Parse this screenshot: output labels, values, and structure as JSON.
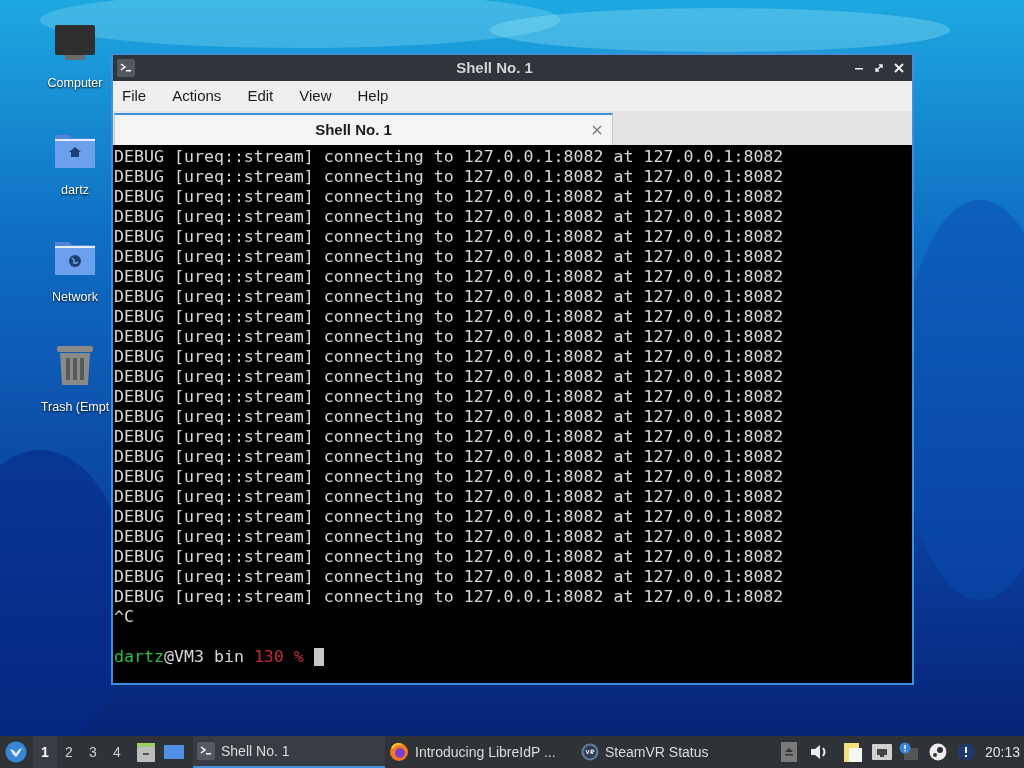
{
  "desktop_icons": [
    {
      "kind": "computer",
      "label": "Computer"
    },
    {
      "kind": "home",
      "label": "dartz"
    },
    {
      "kind": "network",
      "label": "Network"
    },
    {
      "kind": "trash",
      "label": "Trash (Empt"
    }
  ],
  "window": {
    "title": "Shell No. 1",
    "menu": [
      "File",
      "Actions",
      "Edit",
      "View",
      "Help"
    ],
    "tabs": [
      {
        "label": "Shell No. 1",
        "selected": true
      }
    ],
    "terminal": [
      {
        "kind": "output",
        "text": "DEBUG [ureq::stream] connecting to 127.0.0.1:8082 at 127.0.0.1:8082"
      },
      {
        "kind": "output",
        "text": "DEBUG [ureq::stream] connecting to 127.0.0.1:8082 at 127.0.0.1:8082"
      },
      {
        "kind": "output",
        "text": "DEBUG [ureq::stream] connecting to 127.0.0.1:8082 at 127.0.0.1:8082"
      },
      {
        "kind": "output",
        "text": "DEBUG [ureq::stream] connecting to 127.0.0.1:8082 at 127.0.0.1:8082"
      },
      {
        "kind": "output",
        "text": "DEBUG [ureq::stream] connecting to 127.0.0.1:8082 at 127.0.0.1:8082"
      },
      {
        "kind": "output",
        "text": "DEBUG [ureq::stream] connecting to 127.0.0.1:8082 at 127.0.0.1:8082"
      },
      {
        "kind": "output",
        "text": "DEBUG [ureq::stream] connecting to 127.0.0.1:8082 at 127.0.0.1:8082"
      },
      {
        "kind": "output",
        "text": "DEBUG [ureq::stream] connecting to 127.0.0.1:8082 at 127.0.0.1:8082"
      },
      {
        "kind": "output",
        "text": "DEBUG [ureq::stream] connecting to 127.0.0.1:8082 at 127.0.0.1:8082"
      },
      {
        "kind": "output",
        "text": "DEBUG [ureq::stream] connecting to 127.0.0.1:8082 at 127.0.0.1:8082"
      },
      {
        "kind": "output",
        "text": "DEBUG [ureq::stream] connecting to 127.0.0.1:8082 at 127.0.0.1:8082"
      },
      {
        "kind": "output",
        "text": "DEBUG [ureq::stream] connecting to 127.0.0.1:8082 at 127.0.0.1:8082"
      },
      {
        "kind": "output",
        "text": "DEBUG [ureq::stream] connecting to 127.0.0.1:8082 at 127.0.0.1:8082"
      },
      {
        "kind": "output",
        "text": "DEBUG [ureq::stream] connecting to 127.0.0.1:8082 at 127.0.0.1:8082"
      },
      {
        "kind": "output",
        "text": "DEBUG [ureq::stream] connecting to 127.0.0.1:8082 at 127.0.0.1:8082"
      },
      {
        "kind": "output",
        "text": "DEBUG [ureq::stream] connecting to 127.0.0.1:8082 at 127.0.0.1:8082"
      },
      {
        "kind": "output",
        "text": "DEBUG [ureq::stream] connecting to 127.0.0.1:8082 at 127.0.0.1:8082"
      },
      {
        "kind": "output",
        "text": "DEBUG [ureq::stream] connecting to 127.0.0.1:8082 at 127.0.0.1:8082"
      },
      {
        "kind": "output",
        "text": "DEBUG [ureq::stream] connecting to 127.0.0.1:8082 at 127.0.0.1:8082"
      },
      {
        "kind": "output",
        "text": "DEBUG [ureq::stream] connecting to 127.0.0.1:8082 at 127.0.0.1:8082"
      },
      {
        "kind": "output",
        "text": "DEBUG [ureq::stream] connecting to 127.0.0.1:8082 at 127.0.0.1:8082"
      },
      {
        "kind": "output",
        "text": "DEBUG [ureq::stream] connecting to 127.0.0.1:8082 at 127.0.0.1:8082"
      },
      {
        "kind": "output",
        "text": "DEBUG [ureq::stream] connecting to 127.0.0.1:8082 at 127.0.0.1:8082"
      },
      {
        "kind": "output",
        "text": "^C"
      },
      {
        "kind": "blank"
      },
      {
        "kind": "prompt",
        "user": "dartz",
        "host": "@VM3 bin",
        "status": "130 %"
      }
    ]
  },
  "taskbar": {
    "workspaces": [
      {
        "label": "1",
        "selected": true
      },
      {
        "label": "2",
        "selected": false
      },
      {
        "label": "3",
        "selected": false
      },
      {
        "label": "4",
        "selected": false
      }
    ],
    "tasks": [
      {
        "kind": "terminal",
        "label": "Shell No. 1",
        "selected": true
      },
      {
        "kind": "browser",
        "label": "Introducing LibreIdP ...",
        "selected": false
      },
      {
        "kind": "vr",
        "label": "SteamVR Status",
        "selected": false
      }
    ],
    "clock": "20:13"
  }
}
